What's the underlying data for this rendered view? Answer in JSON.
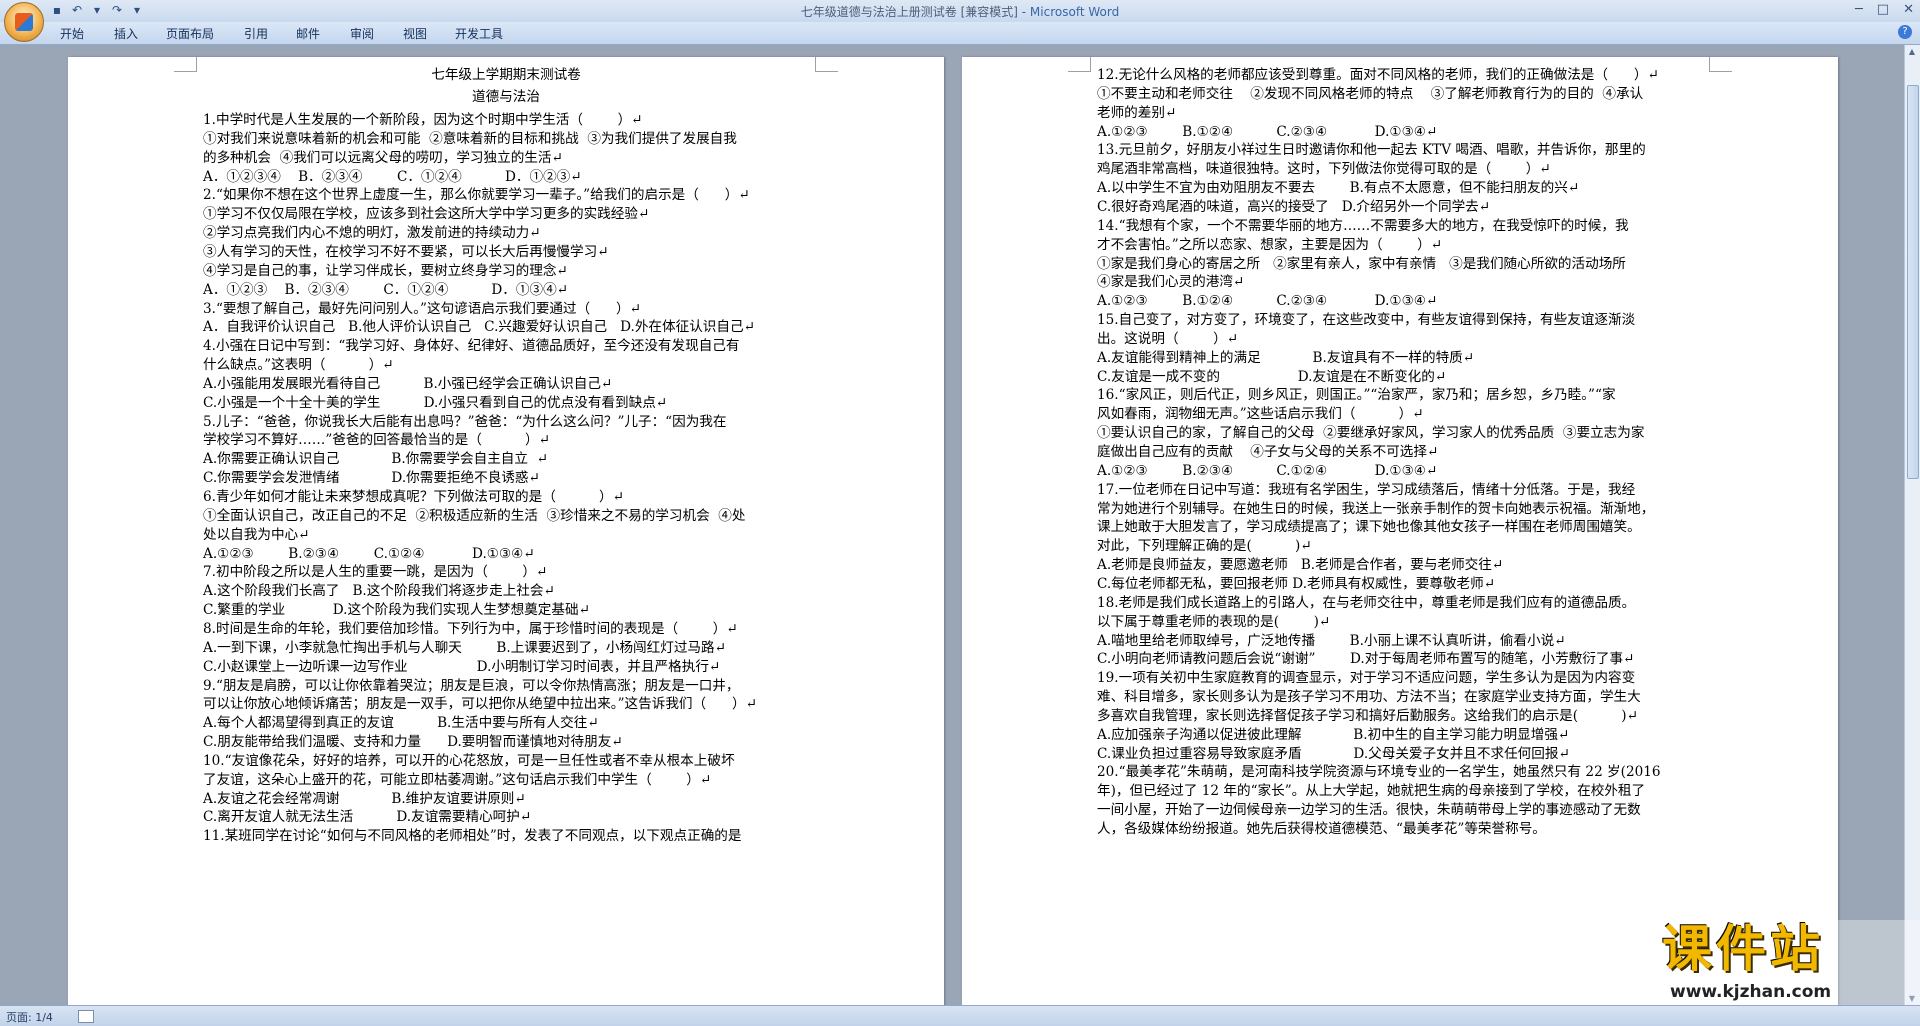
{
  "window": {
    "title": "七年级道德与法治上册测试卷 [兼容模式] - ",
    "app_name": "Microsoft Word"
  },
  "ribbon": {
    "tabs": [
      "开始",
      "插入",
      "页面布局",
      "引用",
      "邮件",
      "审阅",
      "视图",
      "开发工具"
    ]
  },
  "status": {
    "page": "页面: 1/4"
  },
  "watermark": {
    "text": "课件站",
    "url": "www.kjzhan.com"
  },
  "page1": {
    "title": "七年级上学期期末测试卷",
    "subtitle": "道德与法治",
    "lines": [
      "1.中学时代是人生发展的一个新阶段，因为这个时期中学生活（        ）↵",
      "①对我们来说意味着新的机会和可能  ②意味着新的目标和挑战  ③为我们提供了发展自我",
      "的多种机会  ④我们可以远离父母的唠叨，学习独立的生活↵",
      "A．①②③④    B．②③④        C．①②④          D．①②③↵",
      "2.“如果你不想在这个世界上虚度一生，那么你就要学习一辈子。”给我们的启示是（      ）↵",
      "①学习不仅仅局限在学校，应该多到社会这所大学中学习更多的实践经验↵",
      "②学习点亮我们内心不熄的明灯，激发前进的持续动力↵",
      "③人有学习的天性，在校学习不好不要紧，可以长大后再慢慢学习↵",
      "④学习是自己的事，让学习伴成长，要树立终身学习的理念↵",
      "A．①②③    B．②③④        C．①②④          D．①③④↵",
      "3.“要想了解自己，最好先问问别人。”这句谚语启示我们要通过（      ）↵",
      "A．自我评价认识自己   B.他人评价认识自己   C.兴趣爱好认识自己   D.外在体征认识自己↵",
      "4.小强在日记中写到：“我学习好、身体好、纪律好、道德品质好，至今还没有发现自己有",
      "什么缺点。”这表明（          ）↵",
      "A.小强能用发展眼光看待自己          B.小强已经学会正确认识自己↵",
      "C.小强是一个十全十美的学生          D.小强只看到自己的优点没有看到缺点↵",
      "5.儿子：“爸爸，你说我长大后能有出息吗？”爸爸：“为什么这么问？”儿子：“因为我在",
      "学校学习不算好……”爸爸的回答最恰当的是（          ）↵",
      "A.你需要正确认识自己            B.你需要学会自主自立  ↵",
      "C.你需要学会发泄情绪            D.你需要拒绝不良诱惑↵",
      "6.青少年如何才能让未来梦想成真呢？下列做法可取的是（          ）↵",
      "①全面认识自己，改正自己的不足  ②积极适应新的生活  ③珍惜来之不易的学习机会  ④处",
      "处以自我为中心↵",
      "A.①②③        B.②③④        C.①②④           D.①③④↵",
      "7.初中阶段之所以是人生的重要一跳，是因为（        ）↵",
      "A.这个阶段我们长高了   B.这个阶段我们将逐步走上社会↵",
      "C.繁重的学业           D.这个阶段为我们实现人生梦想奠定基础↵",
      "8.时间是生命的年轮，我们要倍加珍惜。下列行为中，属于珍惜时间的表现是（        ）↵",
      "A.一到下课，小李就急忙掏出手机与人聊天        B.上课要迟到了，小杨闯红灯过马路↵",
      "C.小赵课堂上一边听课一边写作业                D.小明制订学习时间表，并且严格执行↵",
      "9.“朋友是肩膀，可以让你依靠着哭泣；朋友是巨浪，可以令你热情高涨；朋友是一口井，",
      "可以让你放心地倾诉痛苦；朋友是一双手，可以把你从绝望中拉出来。”这告诉我们（      ）↵",
      "A.每个人都渴望得到真正的友谊          B.生活中要与所有人交往↵",
      "C.朋友能带给我们温暖、支持和力量      D.要明智而谨慎地对待朋友↵",
      "10.“友谊像花朵，好好的培养，可以开的心花怒放，可是一旦任性或者不幸从根本上破坏",
      "了友谊，这朵心上盛开的花，可能立即枯萎凋谢。”这句话启示我们中学生（        ）↵",
      "A.友谊之花会经常凋谢            B.维护友谊要讲原则↵",
      "C.离开友谊人就无法生活          D.友谊需要精心呵护↵",
      "11.某班同学在讨论“如何与不同风格的老师相处”时，发表了不同观点，以下观点正确的是"
    ]
  },
  "page2": {
    "lines": [
      "12.无论什么风格的老师都应该受到尊重。面对不同风格的老师，我们的正确做法是（      ）↵",
      "①不要主动和老师交往    ②发现不同风格老师的特点    ③了解老师教育行为的目的  ④承认",
      "老师的差别↵",
      "A.①②③        B.①②④          C.②③④           D.①③④↵",
      "13.元旦前夕，好朋友小祥过生日时邀请你和他一起去 KTV 喝酒、唱歌，并告诉你，那里的",
      "鸡尾酒非常高档，味道很独特。这时，下列做法你觉得可取的是（        ）↵",
      "A.以中学生不宜为由劝阻朋友不要去        B.有点不太愿意，但不能扫朋友的兴↵",
      "C.很好奇鸡尾酒的味道，高兴的接受了   D.介绍另外一个同学去↵",
      "14.“我想有个家，一个不需要华丽的地方……不需要多大的地方，在我受惊吓的时候，我",
      "才不会害怕。”之所以恋家、想家，主要是因为（        ）↵",
      "①家是我们身心的寄居之所   ②家里有亲人，家中有亲情   ③是我们随心所欲的活动场所",
      "④家是我们心灵的港湾↵",
      "A.①②③        B.①②④          C.②③④           D.①③④↵",
      "15.自己变了，对方变了，环境变了，在这些改变中，有些友谊得到保持，有些友谊逐渐淡",
      "出。这说明（        ）↵",
      "A.友谊能得到精神上的满足            B.友谊具有不一样的特质↵",
      "C.友谊是一成不变的                  D.友谊是在不断变化的↵",
      "16.“家风正，则后代正，则乡风正，则国正。”“治家严，家乃和；居乡恕，乡乃睦。”“家",
      "风如春雨，润物细无声。”这些话启示我们（          ）↵",
      "①要认识自己的家，了解自己的父母  ②要继承好家风，学习家人的优秀品质  ③要立志为家",
      "庭做出自己应有的贡献    ④子女与父母的关系不可选择↵",
      "A.①②③        B.②③④          C.①②④           D.①③④↵",
      "17.一位老师在日记中写道：我班有名学困生，学习成绩落后，情绪十分低落。于是，我经",
      "常为她进行个别辅导。在她生日的时候，我送上一张亲手制作的贺卡向她表示祝福。渐渐地，",
      "课上她敢于大胆发言了，学习成绩提高了；课下她也像其他女孩子一样围在老师周围嬉笑。",
      "对此，下列理解正确的是(          )↵",
      "A.老师是良师益友，要愿邀老师   B.老师是合作者，要与老师交往↵",
      "C.每位老师都无私，要回报老师 D.老师具有权威性，要尊敬老师↵",
      "18.老师是我们成长道路上的引路人，在与老师交往中，尊重老师是我们应有的道德品质。",
      "以下属于尊重老师的表现的是(        )↵",
      "A.喵地里给老师取绰号，广泛地传播        B.小丽上课不认真听讲，偷看小说↵",
      "C.小明向老师请教问题后会说“谢谢”        D.对于每周老师布置写的随笔，小芳敷衍了事↵",
      "19.一项有关初中生家庭教育的调查显示，对于学习不适应问题，学生多认为是因为内容变",
      "难、科目增多，家长则多认为是孩子学习不用功、方法不当；在家庭学业支持方面，学生大",
      "多喜欢自我管理，家长则选择督促孩子学习和搞好后勤服务。这给我们的启示是(          )↵",
      "A.应加强亲子沟通以促进彼此理解            B.初中生的自主学习能力明显增强↵",
      "C.课业负担过重容易导致家庭矛盾            D.父母关爱子女并且不求任何回报↵",
      "20.“最美孝花”朱萌萌，是河南科技学院资源与环境专业的一名学生，她虽然只有 22 岁(2016",
      "年)，但已经过了 12 年的“家长”。从上大学起，她就把生病的母亲接到了学校，在校外租了",
      "一间小屋，开始了一边伺候母亲一边学习的生活。很快，朱萌萌带母上学的事迹感动了无数",
      "人，各级媒体纷纷报道。她先后获得校道德模范、“最美孝花”等荣誉称号。"
    ]
  }
}
